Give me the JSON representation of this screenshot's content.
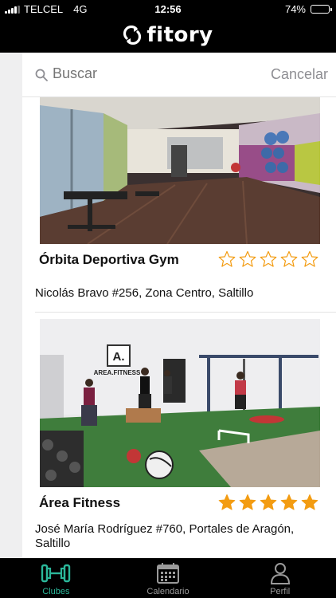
{
  "status_bar": {
    "carrier": "TELCEL",
    "network": "4G",
    "time": "12:56",
    "battery_percent": "74%",
    "battery_level": 0.74
  },
  "header": {
    "brand": "fitory"
  },
  "search": {
    "placeholder": "Buscar",
    "cancel_label": "Cancelar"
  },
  "gyms": [
    {
      "name": "Órbita Deportiva Gym",
      "address": "Nicolás Bravo #256, Zona Centro, Saltillo",
      "rating": 0,
      "max_rating": 5
    },
    {
      "name": "Área Fitness",
      "address": "José María Rodríguez #760, Portales de Aragón, Saltillo",
      "rating": 5,
      "max_rating": 5,
      "sign_text": "A.",
      "sign_caption": "AREA.FITNESS"
    }
  ],
  "tabs": [
    {
      "label": "Clubes",
      "icon": "barbell-icon",
      "active": true
    },
    {
      "label": "Calendario",
      "icon": "calendar-icon",
      "active": false
    },
    {
      "label": "Perfil",
      "icon": "profile-icon",
      "active": false
    }
  ],
  "colors": {
    "accent": "#2bb79a",
    "star": "#f39c12",
    "bar_bg": "#000000"
  }
}
